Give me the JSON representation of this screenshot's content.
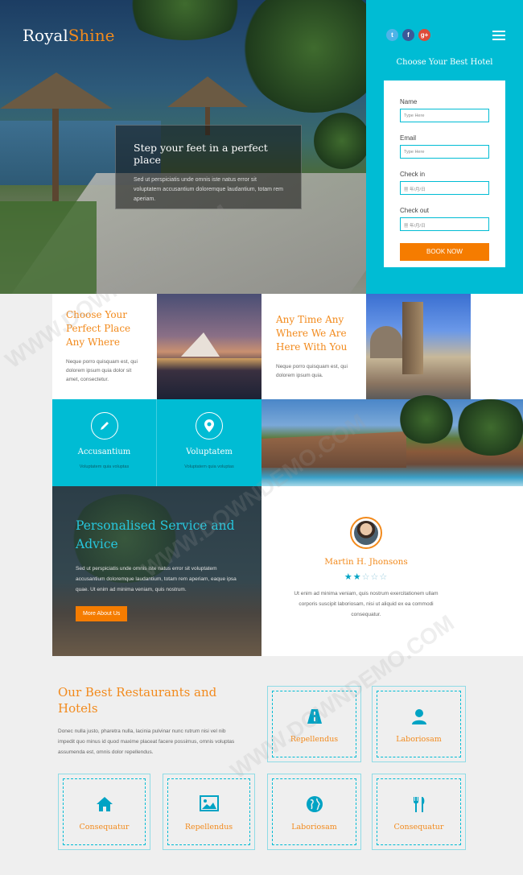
{
  "brand": {
    "name_a": "Royal",
    "name_b": "Shine"
  },
  "hero": {
    "title": "Step your feet in a perfect place",
    "text": "Sed ut perspiciatis unde omnis iste natus error sit voluptatem accusantium doloremque laudantium, totam rem aperiam."
  },
  "social": [
    {
      "icon": "twitter-icon",
      "glyph": "t",
      "color": "#4fb3e8"
    },
    {
      "icon": "facebook-icon",
      "glyph": "f",
      "color": "#3b5998"
    },
    {
      "icon": "google-plus-icon",
      "glyph": "g+",
      "color": "#dd4b39"
    }
  ],
  "booking": {
    "title": "Choose Your Best Hotel",
    "name_label": "Name",
    "name_placeholder": "Type Here",
    "email_label": "Email",
    "email_placeholder": "Type Here",
    "checkin_label": "Check in",
    "checkin_value": "▦ 年/月/日",
    "checkout_label": "Check out",
    "checkout_value": "▦ 年/月/日",
    "button": "BOOK NOW"
  },
  "features": {
    "f1_title": "Choose Your Perfect Place Any Where",
    "f1_text": "Neque porro quisquam est, qui dolorem ipsum quia dolor sit amet, consectetur.",
    "f2_title": "Any Time Any Where We Are Here With You",
    "f2_text": "Neque porro quisquam est, qui dolorem ipsum quia."
  },
  "services": [
    {
      "icon": "pencil-icon",
      "title": "Accusantium",
      "sub": "Voluptatem quia voluptas"
    },
    {
      "icon": "location-icon",
      "title": "Voluptatem",
      "sub": "Voluptatem quia voluptas"
    }
  ],
  "advice": {
    "title": "Personalised Service and Advice",
    "text": "Sed ut perspiciatis unde omnis iste natus error sit voluptatem accusantium doloremque laudantium, totam rem aperiam, eaque ipsa quae. Ut enim ad minima veniam, quis nostrum.",
    "button": "More About Us"
  },
  "testimonial": {
    "name": "Martin H. Jhonsons",
    "rating": 2,
    "max_rating": 5,
    "text": "Ut enim ad minima veniam, quis nostrum exercitationem ullam corporis suscipit laboriosam, nisi ut aliquid ex ea commodi consequatur."
  },
  "restaurants": {
    "title": "Our Best Restaurants and Hotels",
    "text": "Donec nulla justo, pharetra nulla, lacinia pulvinar nunc rutrum nisi vel nib impedit quo minus id quod maxime placeat facere possimus, omnis voluptas assumenda est, omnis dolor repellendus.",
    "cards": [
      {
        "icon": "road-icon",
        "label": "Repellendus"
      },
      {
        "icon": "user-icon",
        "label": "Laboriosam"
      },
      {
        "icon": "home-icon",
        "label": "Consequatur"
      },
      {
        "icon": "image-icon",
        "label": "Repellendus"
      },
      {
        "icon": "globe-icon",
        "label": "Laboriosam"
      },
      {
        "icon": "cutlery-icon",
        "label": "Consequatur"
      }
    ]
  },
  "watermark": "WWW.DOWNDEMO.COM"
}
